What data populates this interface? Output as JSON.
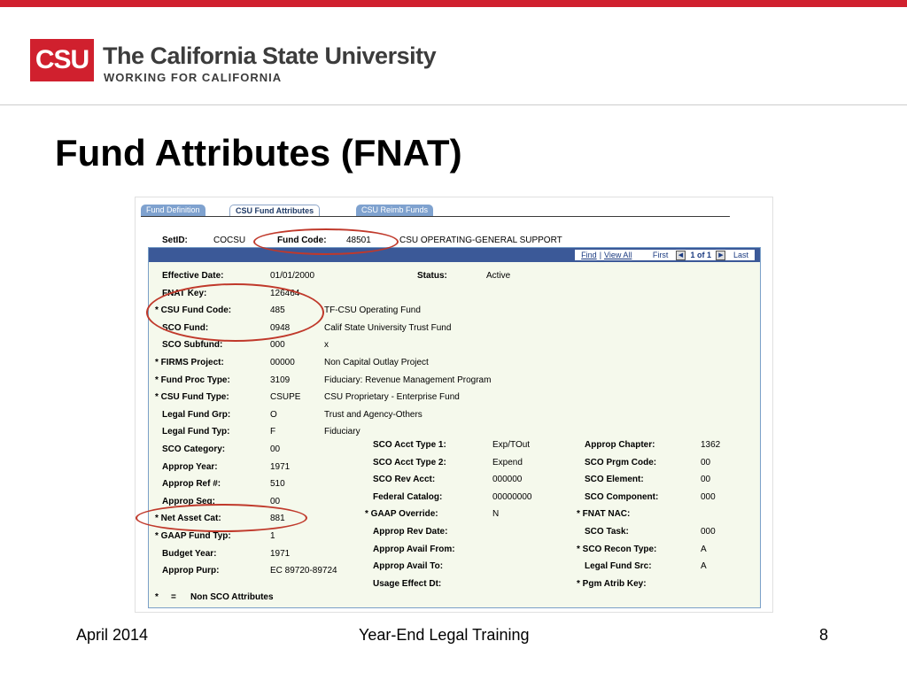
{
  "header": {
    "logo_text": "CSU",
    "org_name": "The California State University",
    "tagline": "WORKING FOR CALIFORNIA"
  },
  "slide": {
    "title": "Fund Attributes (FNAT)"
  },
  "screen": {
    "tabs": [
      {
        "label": "Fund Definition"
      },
      {
        "label": "CSU Fund Attributes"
      },
      {
        "label": "CSU Reimb Funds"
      }
    ],
    "setid_label": "SetID:",
    "setid_value": "COCSU",
    "fund_code_label": "Fund Code:",
    "fund_code_value": "48501",
    "fund_code_desc": "CSU OPERATING-GENERAL SUPPORT",
    "nav": {
      "find": "Find",
      "view_all": "View All",
      "first": "First",
      "count": "1 of 1",
      "last": "Last"
    },
    "left_fields": [
      {
        "label": "Effective Date:",
        "value": "01/01/2000",
        "desc": ""
      },
      {
        "label": "FNAT Key:",
        "value": "126464",
        "desc": ""
      },
      {
        "label": "* CSU Fund Code:",
        "value": "485",
        "desc": "TF-CSU Operating Fund"
      },
      {
        "label": "SCO Fund:",
        "value": "0948",
        "desc": "Calif State University Trust Fund"
      },
      {
        "label": "SCO Subfund:",
        "value": "000",
        "desc": "x"
      },
      {
        "label": "* FIRMS Project:",
        "value": "00000",
        "desc": "Non Capital Outlay Project"
      },
      {
        "label": "* Fund Proc Type:",
        "value": "3109",
        "desc": "Fiduciary: Revenue Management Program"
      },
      {
        "label": "* CSU Fund Type:",
        "value": "CSUPE",
        "desc": "CSU Proprietary - Enterprise Fund"
      },
      {
        "label": "Legal Fund Grp:",
        "value": "O",
        "desc": "Trust and Agency-Others"
      },
      {
        "label": "Legal Fund Typ:",
        "value": "F",
        "desc": "Fiduciary"
      },
      {
        "label": "SCO Category:",
        "value": "00",
        "desc": ""
      },
      {
        "label": "Approp Year:",
        "value": "1971",
        "desc": ""
      },
      {
        "label": "Approp Ref #:",
        "value": "510",
        "desc": ""
      },
      {
        "label": "Approp Seq:",
        "value": "00",
        "desc": ""
      },
      {
        "label": "* Net Asset Cat:",
        "value": "881",
        "desc": ""
      },
      {
        "label": "* GAAP Fund Typ:",
        "value": "1",
        "desc": ""
      },
      {
        "label": "Budget Year:",
        "value": "1971",
        "desc": ""
      },
      {
        "label": "Approp Purp:",
        "value": "EC 89720-89724",
        "desc": ""
      }
    ],
    "status_label": "Status:",
    "status_value": "Active",
    "mid_fields": [
      {
        "label": "SCO Acct Type 1:",
        "value": "Exp/TOut"
      },
      {
        "label": "SCO Acct Type 2:",
        "value": "Expend"
      },
      {
        "label": "SCO Rev Acct:",
        "value": "000000"
      },
      {
        "label": "Federal Catalog:",
        "value": "00000000"
      },
      {
        "label": "* GAAP Override:",
        "value": "N"
      },
      {
        "label": "Approp Rev Date:",
        "value": ""
      },
      {
        "label": "Approp Avail From:",
        "value": ""
      },
      {
        "label": "Approp Avail To:",
        "value": ""
      },
      {
        "label": "Usage Effect Dt:",
        "value": ""
      }
    ],
    "right_fields": [
      {
        "label": "Approp Chapter:",
        "value": "1362"
      },
      {
        "label": "SCO Prgm Code:",
        "value": "00"
      },
      {
        "label": "SCO Element:",
        "value": "00"
      },
      {
        "label": "SCO Component:",
        "value": "000"
      },
      {
        "label": "* FNAT NAC:",
        "value": ""
      },
      {
        "label": "SCO Task:",
        "value": "000"
      },
      {
        "label": "* SCO Recon Type:",
        "value": "A"
      },
      {
        "label": "Legal Fund Src:",
        "value": "A"
      },
      {
        "label": "* Pgm Atrib Key:",
        "value": ""
      }
    ],
    "legend_star": "*",
    "legend_eq": "=",
    "legend_text": "Non SCO Attributes"
  },
  "footer": {
    "date": "April 2014",
    "center": "Year-End Legal Training",
    "page": "8"
  },
  "colors": {
    "brand_red": "#d0202e",
    "highlight_circle": "#c0392b",
    "panel_bg": "#f5f9ec",
    "nav_bar": "#3b5998"
  }
}
